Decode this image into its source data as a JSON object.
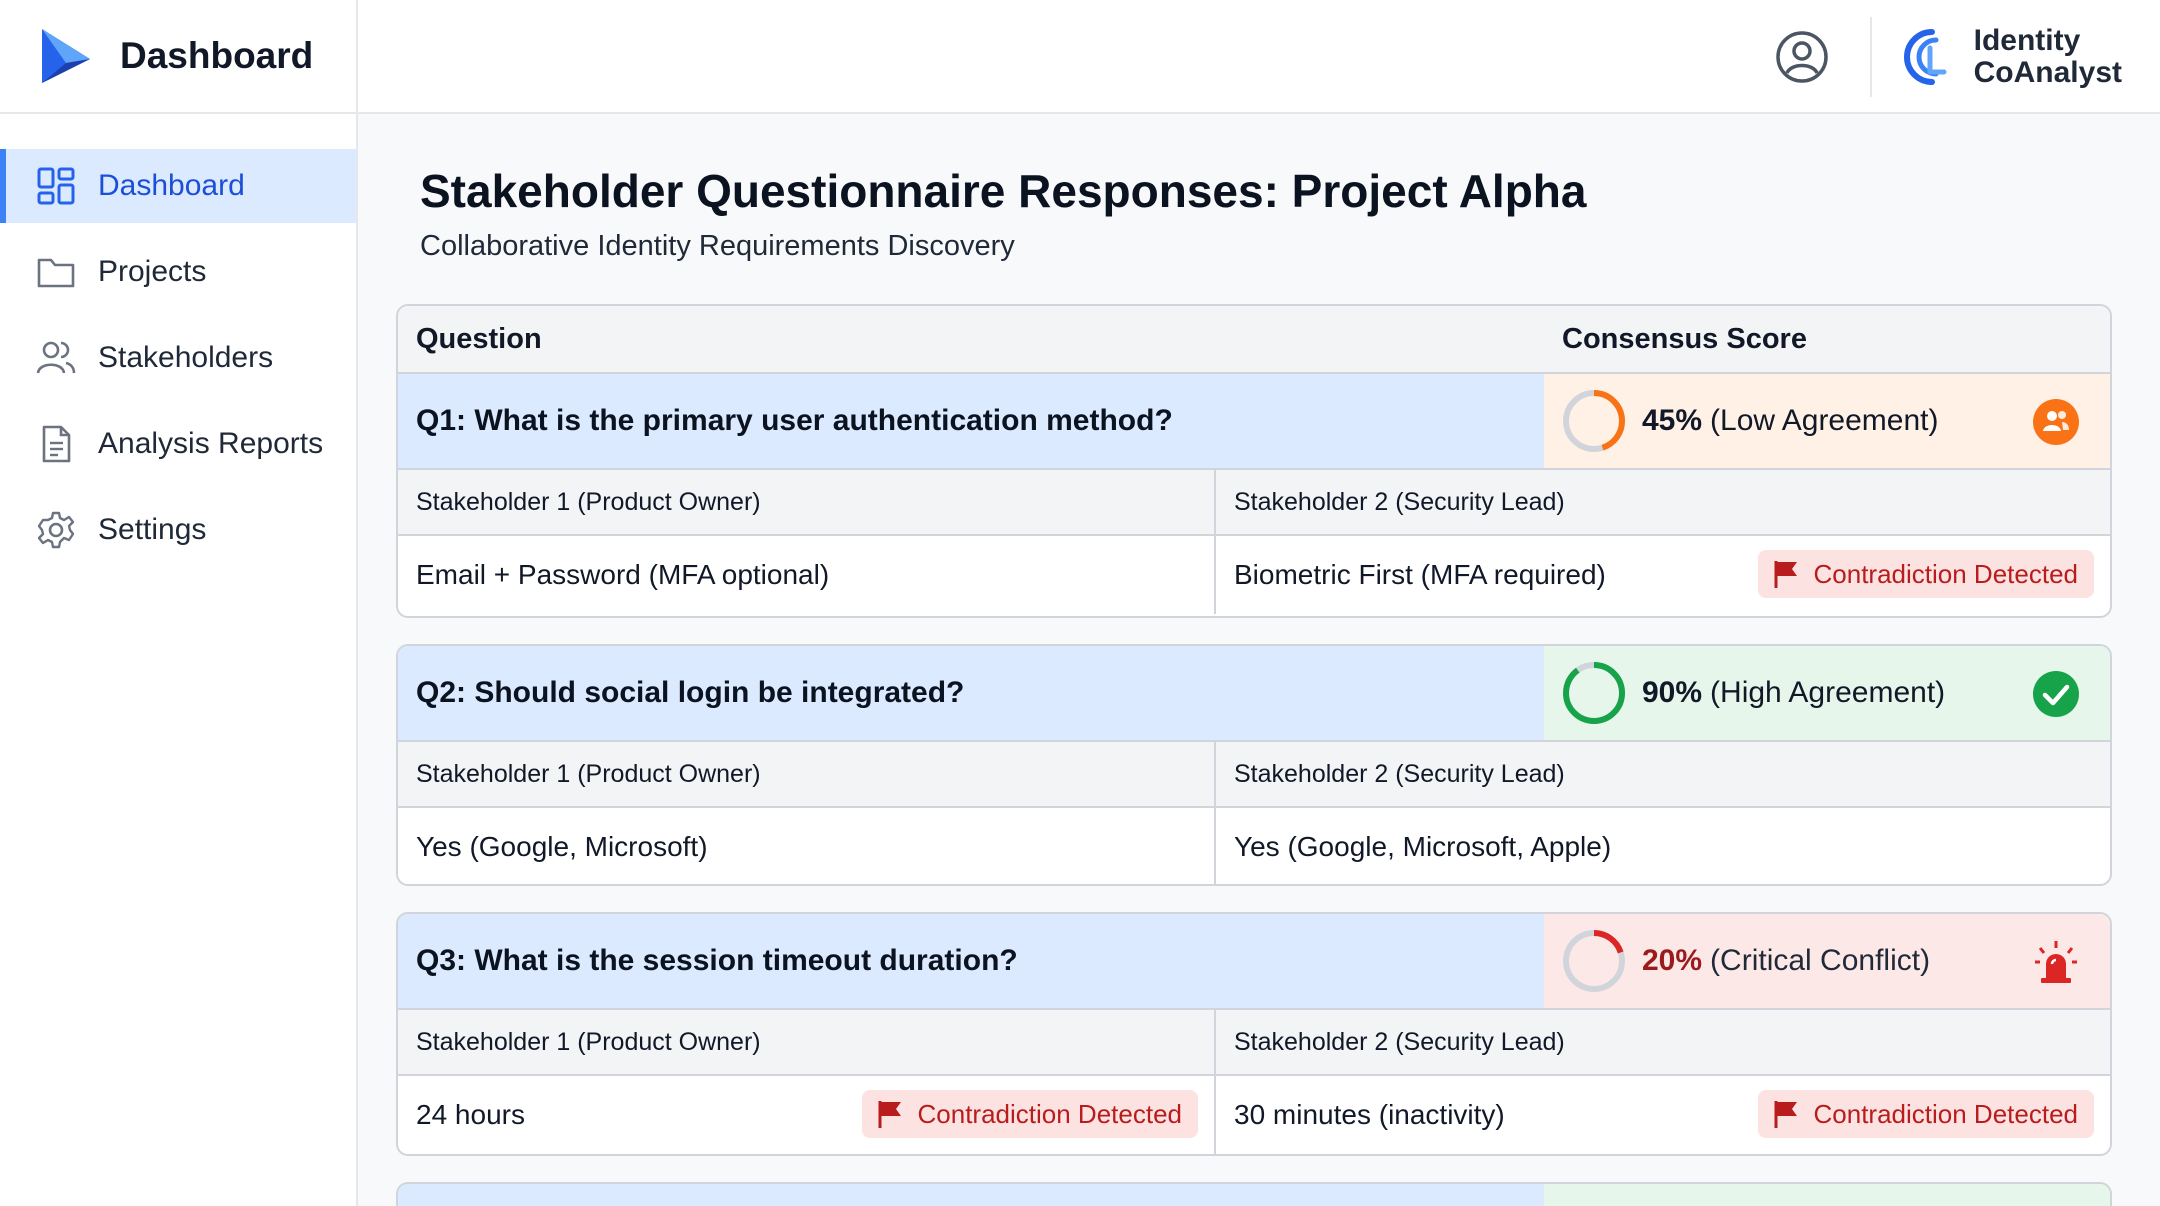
{
  "app": {
    "title": "Dashboard",
    "product_name_line1": "Identity",
    "product_name_line2": "CoAnalyst"
  },
  "sidebar": {
    "items": [
      {
        "label": "Dashboard",
        "icon": "dashboard-grid-icon",
        "active": true
      },
      {
        "label": "Projects",
        "icon": "folder-icon",
        "active": false
      },
      {
        "label": "Stakeholders",
        "icon": "users-icon",
        "active": false
      },
      {
        "label": "Analysis Reports",
        "icon": "document-icon",
        "active": false
      },
      {
        "label": "Settings",
        "icon": "gear-icon",
        "active": false
      }
    ]
  },
  "page": {
    "title": "Stakeholder Questionnaire Responses: Project Alpha",
    "subtitle": "Collaborative Identity Requirements Discovery"
  },
  "table": {
    "header_question": "Question",
    "header_score": "Consensus Score"
  },
  "questions": [
    {
      "question": "Q1: What is the primary user authentication method?",
      "score_pct": "45%",
      "score_value": 45,
      "score_label": "(Low Agreement)",
      "status_icon": "people-alert-icon",
      "stakeholder1": "Stakeholder 1 (Product Owner)",
      "stakeholder2": "Stakeholder 2 (Security Lead)",
      "answer1": "Email + Password (MFA optional)",
      "answer2": "Biometric First (MFA required)",
      "badge1": "",
      "badge2": "Contradiction Detected"
    },
    {
      "question": "Q2: Should social login be integrated?",
      "score_pct": "90%",
      "score_value": 90,
      "score_label": "(High Agreement)",
      "status_icon": "check-circle-icon",
      "stakeholder1": "Stakeholder 1 (Product Owner)",
      "stakeholder2": "Stakeholder 2 (Security Lead)",
      "answer1": "Yes (Google, Microsoft)",
      "answer2": "Yes (Google, Microsoft, Apple)",
      "badge1": "",
      "badge2": ""
    },
    {
      "question": "Q3: What is the session timeout duration?",
      "score_pct": "20%",
      "score_value": 20,
      "score_label": "(Critical Conflict)",
      "status_icon": "siren-icon",
      "stakeholder1": "Stakeholder 1 (Product Owner)",
      "stakeholder2": "Stakeholder 2 (Security Lead)",
      "answer1": "24 hours",
      "answer2": "30 minutes (inactivity)",
      "badge1": "Contradiction Detected",
      "badge2": "Contradiction Detected"
    }
  ],
  "colors": {
    "accent": "#3b82f6",
    "low": "#f97316",
    "high": "#16a34a",
    "critical": "#dc2626",
    "badge_text": "#b91c1c"
  }
}
